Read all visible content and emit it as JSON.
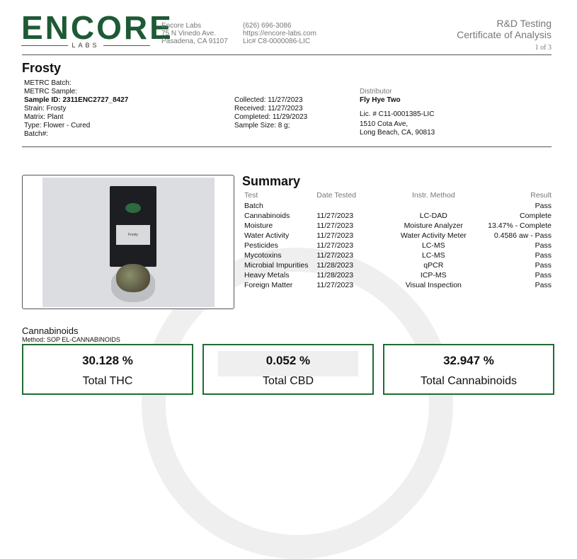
{
  "header": {
    "logo_word": "ENCORE",
    "logo_sub": "LABS",
    "address": [
      "Encore Labs",
      "75 N Vinedo Ave.",
      "Pasadena, CA 91107"
    ],
    "contact": [
      "(626) 696-3086",
      "https://encore-labs.com",
      "Lic# C8-0000086-LIC"
    ],
    "report_title": [
      "R&D Testing",
      "Certificate of Analysis"
    ],
    "page": "1 of 3"
  },
  "sample": {
    "product_name": "Frosty",
    "left": [
      "METRC Batch:",
      "METRC Sample:",
      "Sample ID: 2311ENC2727_8427",
      "Strain: Frosty",
      "Matrix: Plant",
      "Type: Flower - Cured",
      "Batch#:"
    ],
    "middle": [
      "Collected: 11/27/2023",
      "Received: 11/27/2023",
      "Completed: 11/29/2023",
      "Sample Size: 8 g;"
    ],
    "distributor_label": "Distributor",
    "distributor_name": "Fly Hye Two",
    "distributor_lines": [
      "Lic. # C11-0001385-LIC",
      "1510 Cota Ave,",
      "Long Beach, CA, 90813"
    ]
  },
  "photo": {
    "bag_label": "Frosty"
  },
  "summary": {
    "title": "Summary",
    "headers": {
      "test": "Test",
      "date": "Date Tested",
      "method": "Instr. Method",
      "result": "Result"
    },
    "rows": [
      {
        "test": "Batch",
        "date": "",
        "method": "",
        "result": "Pass"
      },
      {
        "test": "Cannabinoids",
        "date": "11/27/2023",
        "method": "LC-DAD",
        "result": "Complete"
      },
      {
        "test": "Moisture",
        "date": "11/27/2023",
        "method": "Moisture Analyzer",
        "result": "13.47% - Complete"
      },
      {
        "test": "Water Activity",
        "date": "11/27/2023",
        "method": "Water Activity Meter",
        "result": "0.4586 aw - Pass"
      },
      {
        "test": "Pesticides",
        "date": "11/27/2023",
        "method": "LC-MS",
        "result": "Pass"
      },
      {
        "test": "Mycotoxins",
        "date": "11/27/2023",
        "method": "LC-MS",
        "result": "Pass"
      },
      {
        "test": "Microbial Impurities",
        "date": "11/28/2023",
        "method": "qPCR",
        "result": "Pass"
      },
      {
        "test": "Heavy Metals",
        "date": "11/28/2023",
        "method": "ICP-MS",
        "result": "Pass"
      },
      {
        "test": "Foreign Matter",
        "date": "11/27/2023",
        "method": "Visual Inspection",
        "result": "Pass"
      }
    ]
  },
  "cannabinoids": {
    "title": "Cannabinoids",
    "method": "Method: SOP EL-CANNABINOIDS",
    "cards": [
      {
        "value": "30.128 %",
        "label": "Total THC"
      },
      {
        "value": "0.052 %",
        "label": "Total CBD"
      },
      {
        "value": "32.947 %",
        "label": "Total Cannabinoids"
      }
    ]
  },
  "colors": {
    "brand_green": "#1d5a35",
    "card_border": "#226b35",
    "muted": "#777777"
  }
}
